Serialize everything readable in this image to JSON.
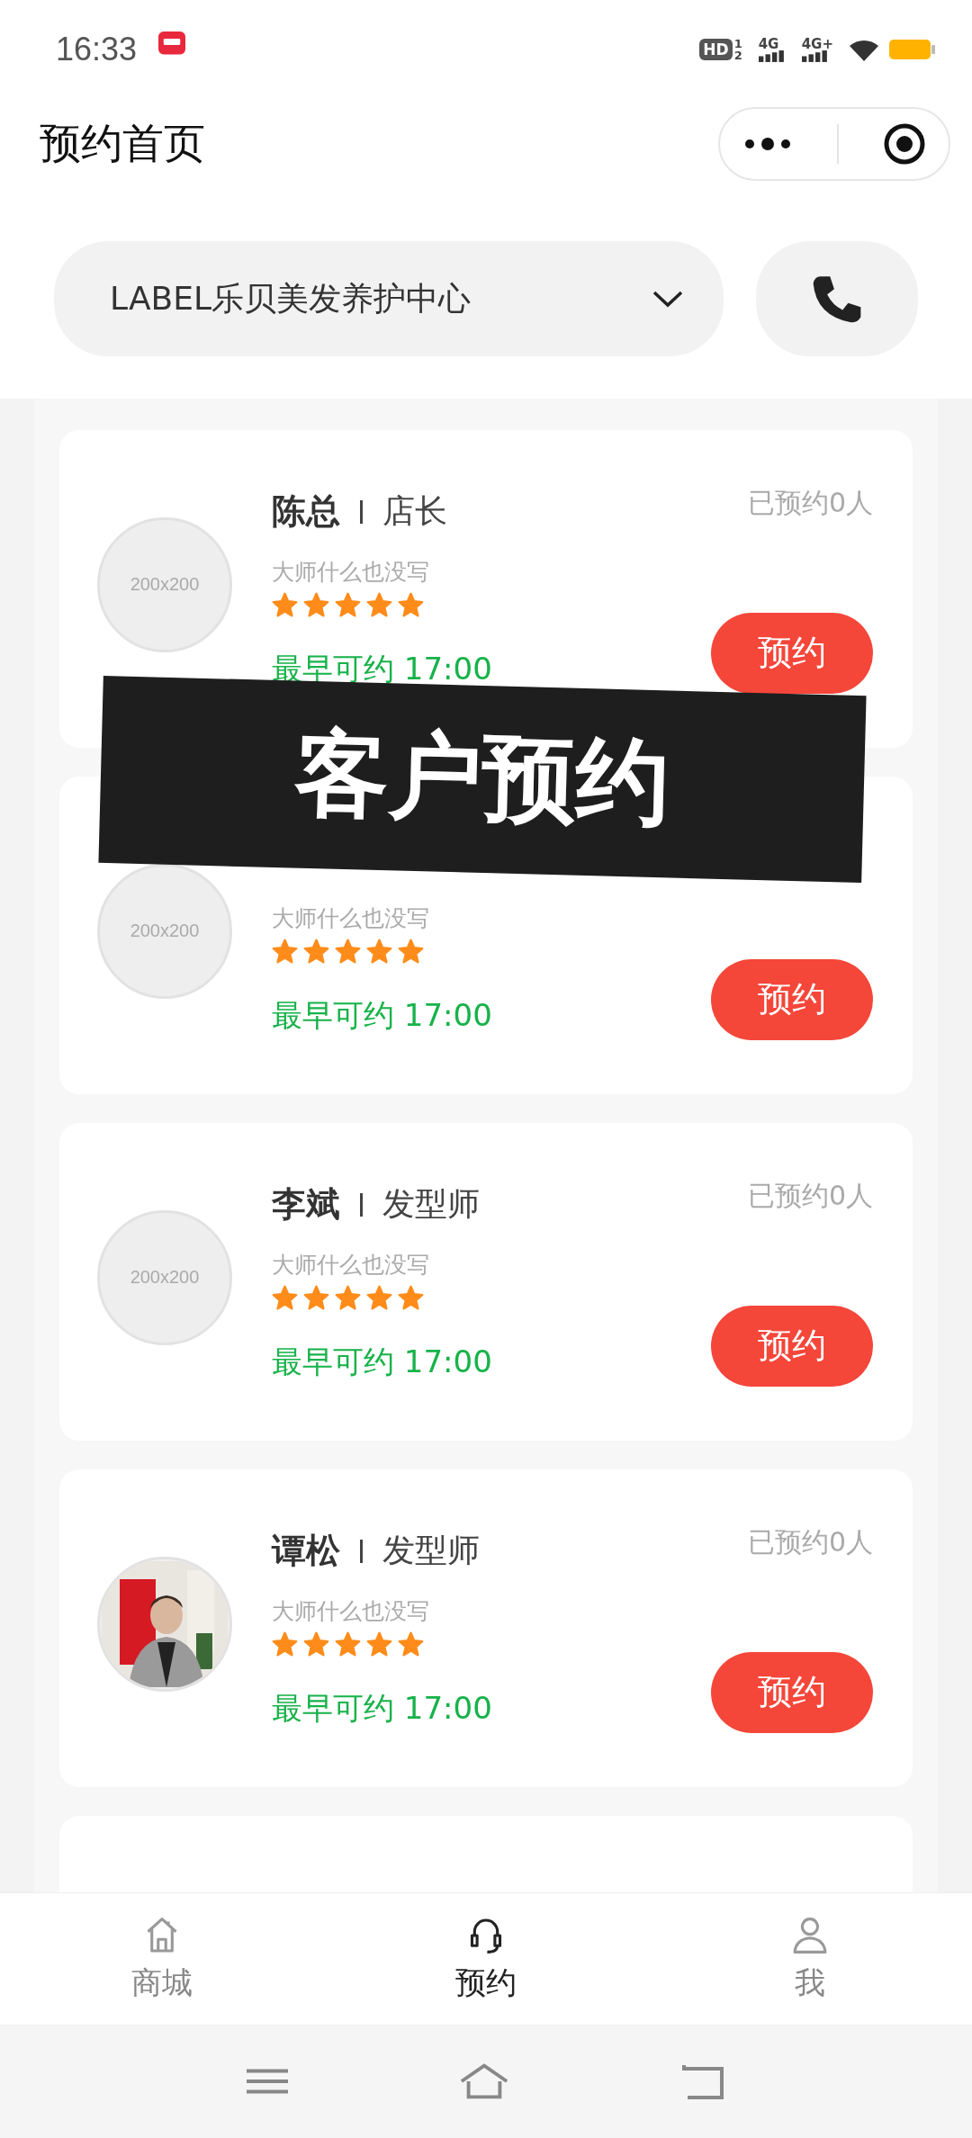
{
  "status_bar": {
    "time": "16:33",
    "hd": {
      "label": "HD",
      "sup": "1",
      "sub": "2"
    },
    "networks": [
      "4G",
      "4G+"
    ]
  },
  "header": {
    "title": "预约首页"
  },
  "store": {
    "name": "LABEL乐贝美发养护中心"
  },
  "stylists": [
    {
      "kind": "card",
      "name": "陈总",
      "role": "店长",
      "booked": "已预约0人",
      "bio": "大师什么也没写",
      "stars": 5,
      "earliest": "最早可约 17:00",
      "avatar": {
        "kind": "placeholder",
        "text": "200x200"
      },
      "button": "预约"
    },
    {
      "kind": "card",
      "bio": "大师什么也没写",
      "stars": 5,
      "earliest": "最早可约 17:00",
      "avatar": {
        "kind": "placeholder",
        "text": "200x200"
      },
      "button": "预约"
    },
    {
      "kind": "card",
      "name": "李斌",
      "role": "发型师",
      "booked": "已预约0人",
      "bio": "大师什么也没写",
      "stars": 5,
      "earliest": "最早可约 17:00",
      "avatar": {
        "kind": "placeholder",
        "text": "200x200"
      },
      "button": "预约"
    },
    {
      "kind": "card",
      "name": "谭松",
      "role": "发型师",
      "booked": "已预约0人",
      "bio": "大师什么也没写",
      "stars": 5,
      "earliest": "最早可约 17:00",
      "button": "预约"
    },
    {
      "kind": "cut"
    }
  ],
  "banner": {
    "text": "客户预约"
  },
  "tabs": [
    {
      "label": "商城",
      "kind": "home",
      "selected": false
    },
    {
      "label": "预约",
      "kind": "headset",
      "selected": true
    },
    {
      "label": "我",
      "kind": "person",
      "selected": false
    }
  ]
}
